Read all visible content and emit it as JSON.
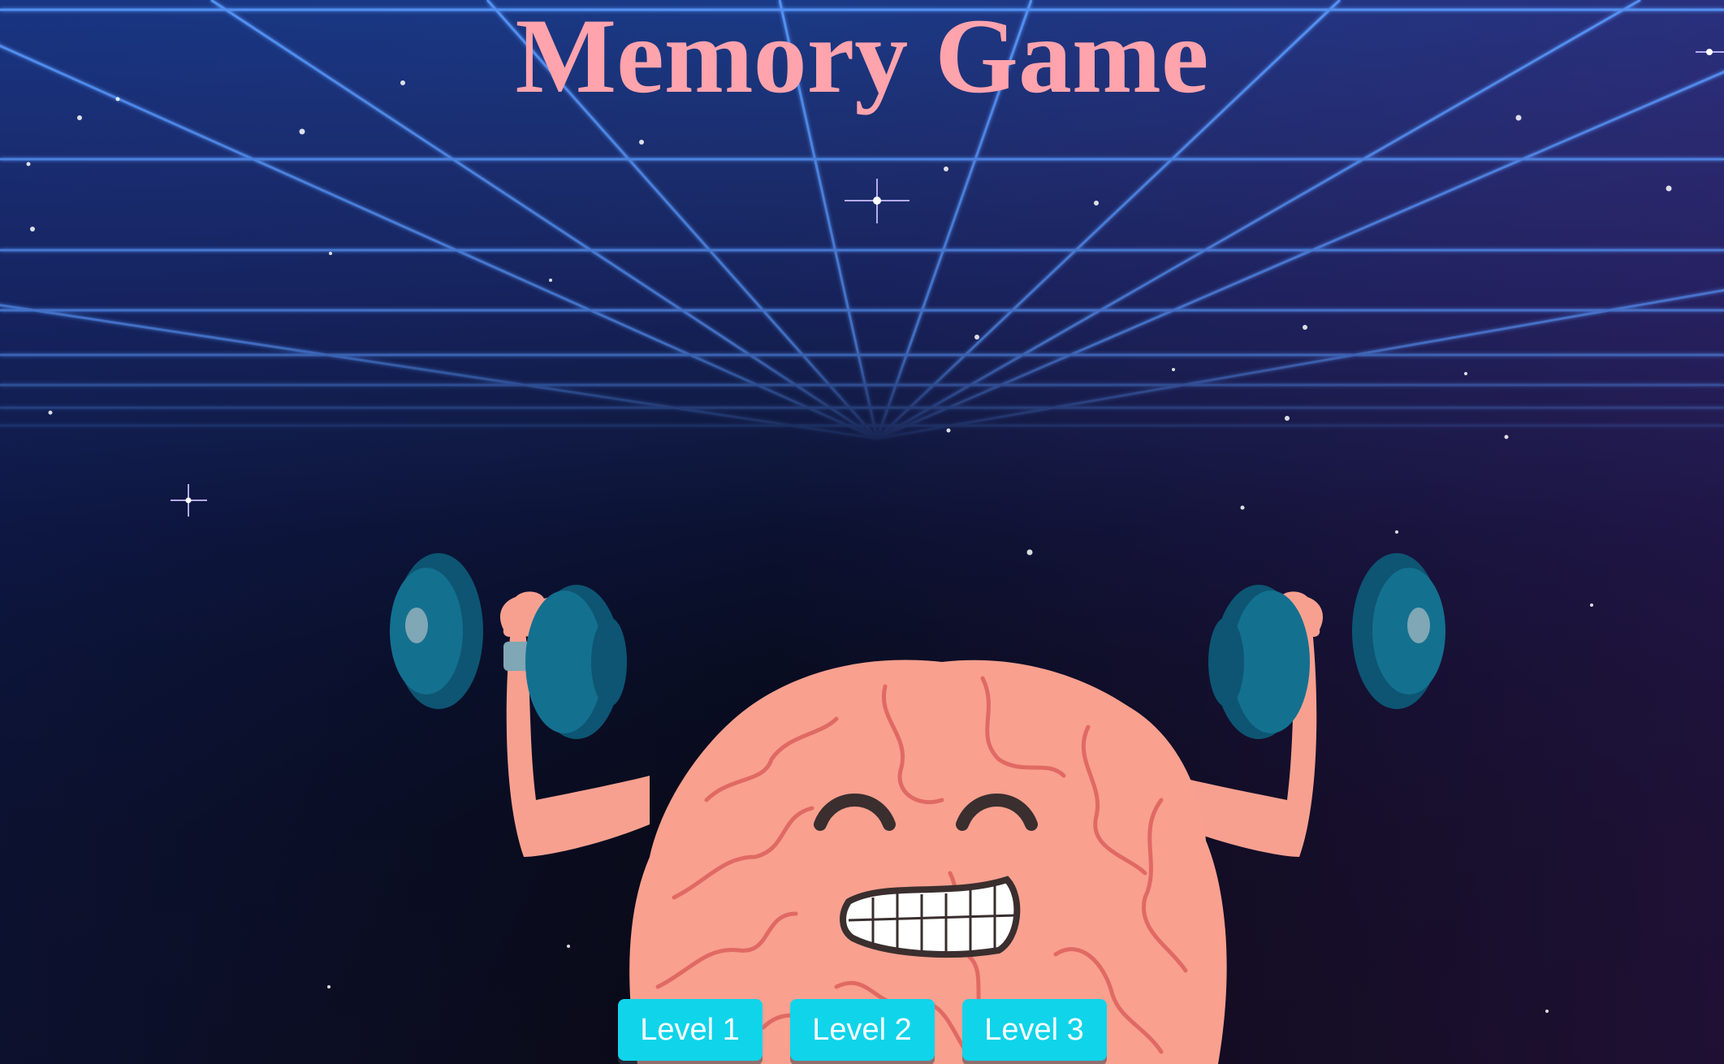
{
  "page": {
    "title": "Memory Game"
  },
  "hero": {
    "illustration": "muscular-brain-lifting-dumbbells",
    "background": "retro-neon-grid-starfield"
  },
  "levels": [
    {
      "label": "Level 1"
    },
    {
      "label": "Level 2"
    },
    {
      "label": "Level 3"
    }
  ],
  "colors": {
    "title": "#ffa3ad",
    "button_bg": "#10d4ea",
    "button_text": "#ffffff",
    "grid_line": "#4a8cff",
    "brain": "#f9a08f",
    "dumbbell": "#0f5a78"
  }
}
